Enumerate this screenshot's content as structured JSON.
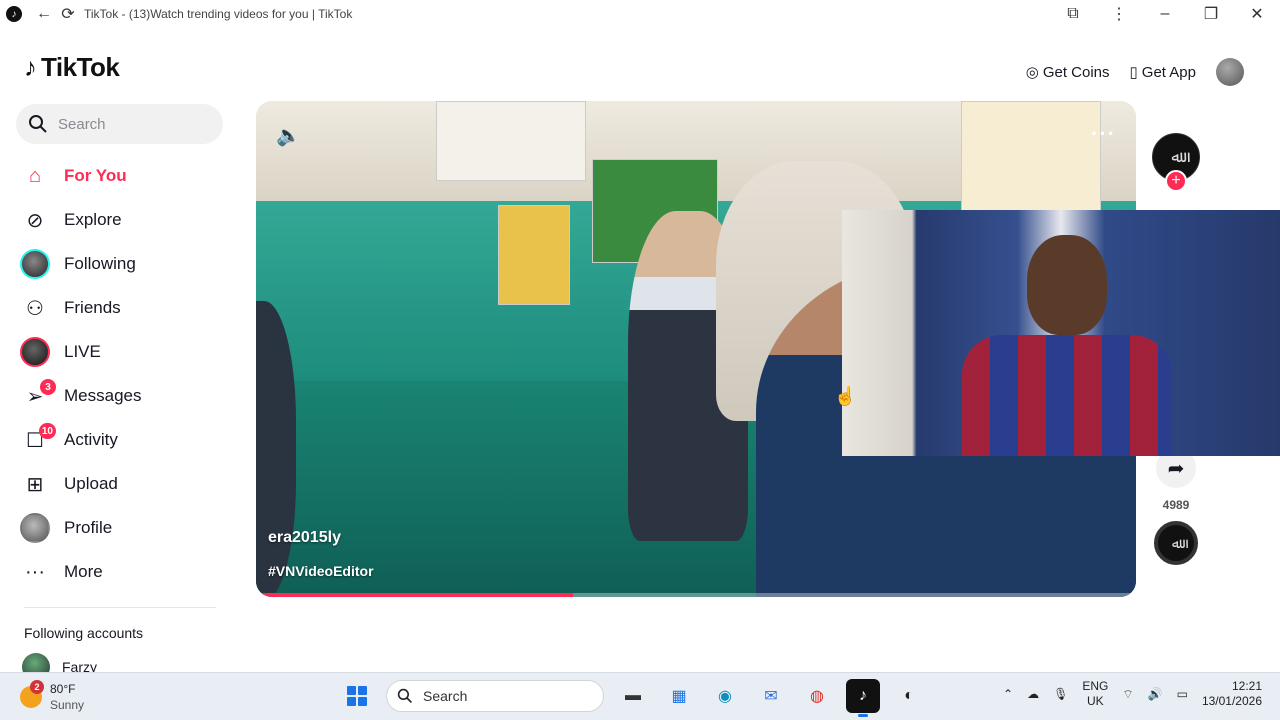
{
  "window": {
    "title": "TikTok - (13)Watch trending videos for you | TikTok"
  },
  "header": {
    "logo_text": "TikTok",
    "get_coins": "Get Coins",
    "get_app": "Get App"
  },
  "search": {
    "placeholder": "Search"
  },
  "nav": {
    "items": [
      {
        "label": "For You",
        "icon": "home-icon"
      },
      {
        "label": "Explore",
        "icon": "compass-icon"
      },
      {
        "label": "Following",
        "icon": "avatar"
      },
      {
        "label": "Friends",
        "icon": "friends-icon"
      },
      {
        "label": "LIVE",
        "icon": "avatar"
      },
      {
        "label": "Messages",
        "icon": "messages-icon",
        "badge": "3"
      },
      {
        "label": "Activity",
        "icon": "activity-icon",
        "badge": "10"
      },
      {
        "label": "Upload",
        "icon": "upload-icon"
      },
      {
        "label": "Profile",
        "icon": "avatar"
      },
      {
        "label": "More",
        "icon": "more-icon"
      }
    ]
  },
  "following": {
    "title": "Following accounts",
    "accounts": [
      {
        "name": "Farzy"
      }
    ]
  },
  "video": {
    "author": "era2015ly",
    "hashtag": "#VNVideoEditor",
    "progress": 0.36,
    "share_count": "4989"
  },
  "taskbar": {
    "weather_badge": "2",
    "temperature": "80°F",
    "condition": "Sunny",
    "search_placeholder": "Search",
    "lang_top": "ENG",
    "lang_bottom": "UK",
    "time": "12:21",
    "date": "13/01/2026"
  },
  "colors": {
    "accent": "#fe2c55",
    "following_ring": "#25f4ee"
  }
}
